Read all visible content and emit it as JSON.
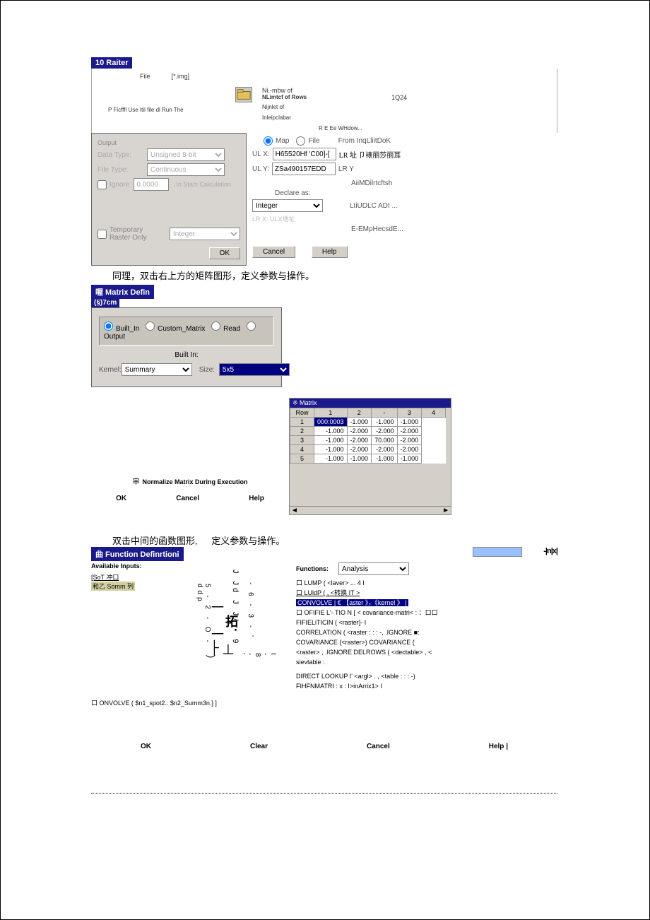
{
  "raster_dlg": {
    "title": "10 Raiter",
    "file_label": "File",
    "img_label": "[*.img]",
    "prompt": "P Ficfffi Use Itil file dl Run The",
    "ni_label": "Ni.-mbw of",
    "nlimtcf_label": "NLimtcf of Rows",
    "nlimtcf_value": "1Q24",
    "nijnlet": "Nijnlet of",
    "interp": "Inleipclabar",
    "ree_window": "R E Ee WHdow...",
    "output_hdr": "Output",
    "data_type_lbl": "Data Type:",
    "data_type_val": "Unsigned 8-bit",
    "file_type_lbl": "File Type:",
    "file_type_val": "Continuous",
    "ignore_lbl": "Ignore",
    "ignore_val": "0.0000",
    "in_stats_calc": "In Stats Calculation",
    "map_label": "Map",
    "file_radio": "File",
    "from_inquire": "From InqLliitDoK",
    "ulx_label": "UL X:",
    "ulx_value": "H65520Hf 'C00]-[",
    "ulx_extra": "LR 址  卩裱丽莎丽耳",
    "uly_label": "UL Y:",
    "uly_value": "ZSa490157EDD",
    "uly_extra": "LR Y",
    "aii_label": "AiiMDilrtcftsh",
    "declare_as": "Declare as:",
    "declare_val": "Integer",
    "liiudlc": "LtiUDLC ADI ...",
    "lrx_extra": "LR X: ULX地址",
    "eemp": "E-EMpHecsdE...",
    "temp_raster_only": "Temporary Raster Only",
    "temp_sel": "Integer",
    "ok": "OK",
    "cancel": "Cancel",
    "help": "Help"
  },
  "cn_text_1": "同理，双击右上方的矩阵图形，定义参数与操作。",
  "matrix_dlg": {
    "title": "喔  Matrix Defin",
    "sub_title": "(§)7cm",
    "built_in": "Built_In",
    "custom_matrix": "Custom_Matrix",
    "read": "Read",
    "output": "Output",
    "built_in_hdr": "Built In:",
    "kernel_lbl": "Kernel:",
    "kernel_val": "Summary",
    "size_lbl": "Size:",
    "size_val": "5x5"
  },
  "matrix_preview": {
    "title": "※ Matrix",
    "row_hdr": "Row",
    "cols": [
      "1",
      "2",
      "-",
      "3",
      "4"
    ],
    "rows": [
      [
        "1",
        "000:0003",
        "-1.000",
        "-1.000",
        "-1.000"
      ],
      [
        "2",
        "-1.000",
        "-2.000",
        "-2.000",
        "-2.000"
      ],
      [
        "3",
        "-1.000",
        "-2.000",
        "70.000",
        "-2.000"
      ],
      [
        "4",
        "-1.000",
        "-2.000",
        "-2.000",
        "-2.000"
      ],
      [
        "5",
        "-1.000",
        "-1.000",
        "-1.000",
        "-1.000"
      ]
    ]
  },
  "normalize_label": "Normalize Matrix During Execution",
  "bottom1": {
    "ok": "OK",
    "cancel": "Cancel",
    "help": "Help"
  },
  "cn_text_2a": "双击中间的函数图形,",
  "cn_text_2b": "定义参数与操作。",
  "func_dlg": {
    "title": "曲  Function Definrtioni",
    "avail_inputs": "Available Inputs:",
    "input_items": [
      "[SoT 冲口",
      "和乙 Somm 列"
    ],
    "functions_lbl": "Functions:",
    "functions_sel": "Analysis",
    "close_label": "-|n|x|",
    "func_items": [
      "口 LUMP ( <laver> ... 4 I",
      "口 LUldP ( , <转换 IT >",
      "CONVOLVE | €  【aster 》，《kernel 》 |",
      "口 OFIFIE L'- TIO N [ < covariance-matri< : ：口口",
      "FIFIELiTICIN ( <raster]- I",
      "CORRELATION ( <raster : : : -, .IGNORE ■:",
      "COVARIANCE (<raster>) COVARIANCE (",
      "<raster> , .IGNORE DELROWS ( <dectable> , <",
      "sievtable :",
      "DIRECT LOOKUP I' <argl> . , <table : : : -)",
      "FIHFNMATRI : x : I>inArrix1> I"
    ],
    "sel_index": 2,
    "expr": "口 ONVOLVE ( $n1_spot2.. $n2_Summ3n.] ]",
    "diagram_vert_1": "J Jd J J/ • 9",
    "diagram_vert_2": "- 6 - 3 - '",
    "diagram_vert_3": "5 - 2 - O - ddp",
    "diagram_vert_4": "I - 8 - '",
    "diagram_center": "拓",
    "ok": "OK",
    "clear": "Clear",
    "cancel": "Cancel",
    "help": "Help |"
  }
}
